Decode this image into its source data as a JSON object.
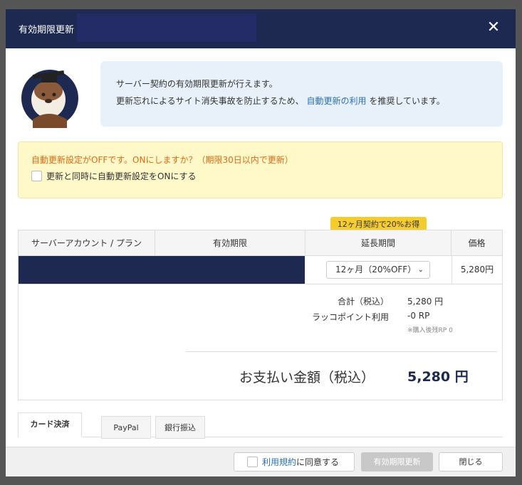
{
  "header": {
    "title": "有効期限更新",
    "close_symbol": "✕"
  },
  "intro": {
    "line1": "サーバー契約の有効期限更新が行えます。",
    "line2_prefix": "更新忘れによるサイト消失事故を防止するため、",
    "line2_link": "自動更新の利用",
    "line2_suffix": "を推奨しています。"
  },
  "notice": {
    "warning": "自動更新設定がOFFです。ONにしますか？（期限30日以内で更新）",
    "checkbox_label": "更新と同時に自動更新設定をONにする"
  },
  "promo_badge": "12ヶ月契約で20%お得",
  "table": {
    "headers": [
      "サーバーアカウント / プラン",
      "有効期限",
      "延長期間",
      "価格"
    ],
    "row": {
      "period_select": "12ヶ月（20%OFF）",
      "price": "5,280円"
    }
  },
  "summary": {
    "total_label": "合計（税込）",
    "total_value": "5,280 円",
    "points_label": "ラッコポイント利用",
    "points_value": "-0 RP",
    "points_note": "※購入後残RP 0",
    "payment_label": "お支払い金額（税込）",
    "payment_value": "5,280 円"
  },
  "tabs": [
    "カード決済",
    "PayPal",
    "銀行振込"
  ],
  "footer": {
    "terms_link": "利用規約",
    "terms_suffix": "に同意する",
    "renew_button": "有効期限更新",
    "close_button": "閉じる"
  },
  "colors": {
    "header_bg": "#1d2951",
    "link": "#2a6fb8",
    "warning": "#e06a14",
    "promo": "#f6cc2d"
  }
}
